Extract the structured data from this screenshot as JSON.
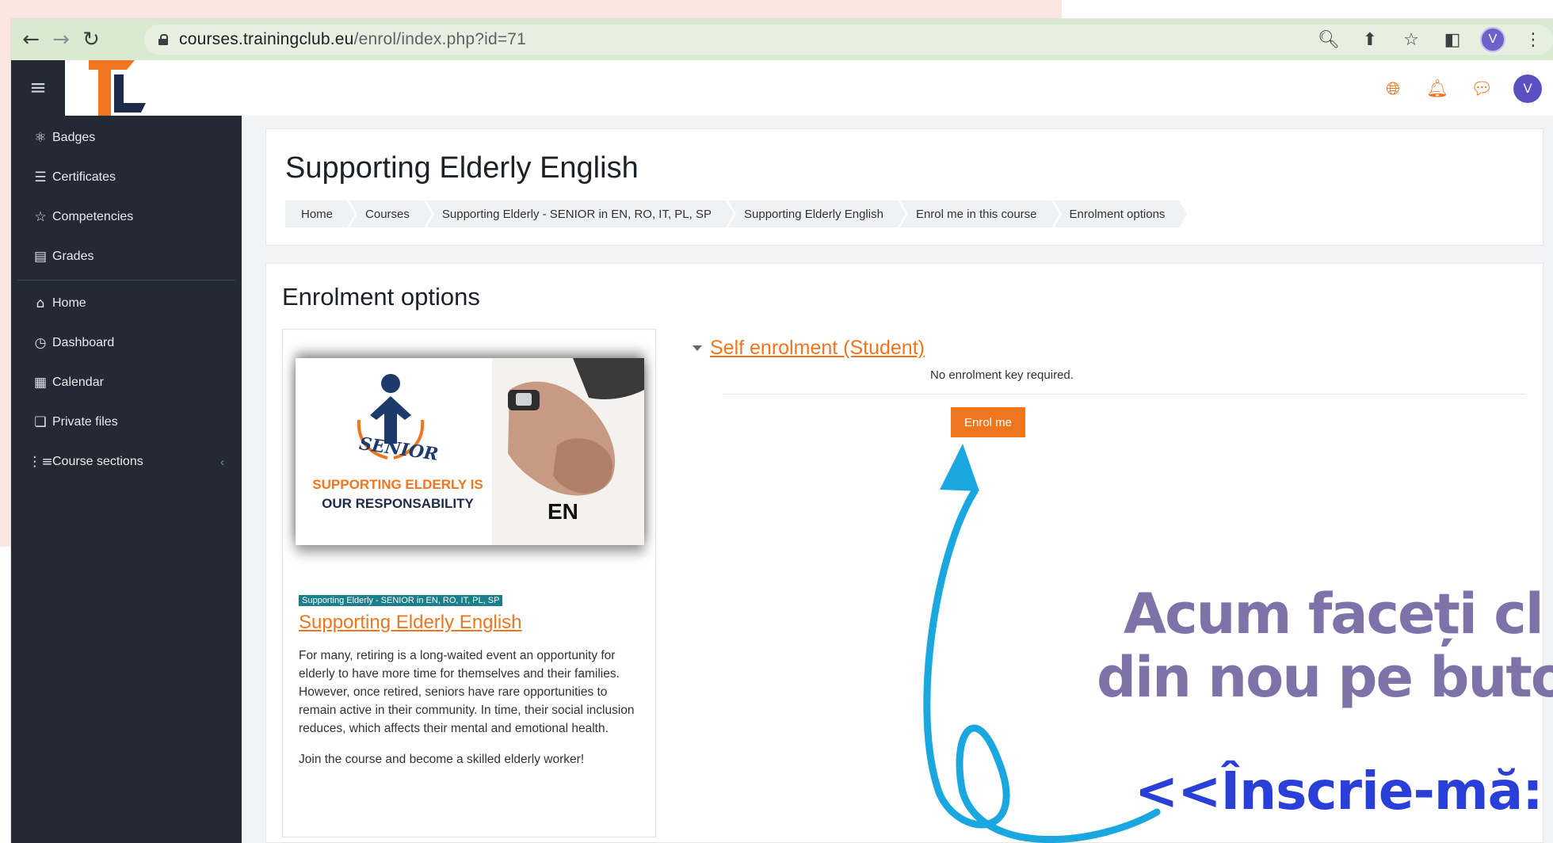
{
  "browser": {
    "url_host": "courses.trainingclub.eu",
    "url_path": "/enrol/index.php?id=71",
    "profile_initial": "V"
  },
  "header": {
    "avatar_initial": "V"
  },
  "sidebar": {
    "items": [
      {
        "label": "Badges",
        "icon": "badge-icon"
      },
      {
        "label": "Certificates",
        "icon": "certificate-icon"
      },
      {
        "label": "Competencies",
        "icon": "star-icon"
      },
      {
        "label": "Grades",
        "icon": "grades-icon"
      },
      {
        "label": "Home",
        "icon": "home-icon"
      },
      {
        "label": "Dashboard",
        "icon": "dashboard-icon"
      },
      {
        "label": "Calendar",
        "icon": "calendar-icon"
      },
      {
        "label": "Private files",
        "icon": "files-icon"
      },
      {
        "label": "Course sections",
        "icon": "list-icon"
      }
    ]
  },
  "page": {
    "title": "Supporting Elderly English",
    "breadcrumb": [
      "Home",
      "Courses",
      "Supporting Elderly - SENIOR in EN, RO, IT, PL, SP",
      "Supporting Elderly English",
      "Enrol me in this course",
      "Enrolment options"
    ],
    "section_title": "Enrolment options"
  },
  "course": {
    "image_text": {
      "senior": "SENIOR",
      "line1": "SUPPORTING ELDERLY IS",
      "line2": "OUR RESPONSABILITY",
      "lang": "EN"
    },
    "category": "Supporting Elderly - SENIOR in EN, RO, IT, PL, SP",
    "name": "Supporting Elderly English",
    "description_1": "For many, retiring is a long-waited event an opportunity for elderly to have more time for themselves and their families. However, once retired, seniors have rare opportunities to remain active in their community. In time, their social inclusion reduces, which affects their mental and emotional health.",
    "description_2": "Join the course and become a skilled elderly worker!"
  },
  "enrolment": {
    "method_title": "Self enrolment (Student)",
    "note": "No enrolment key required.",
    "button_label": "Enrol me"
  },
  "annotation": {
    "line1": "Acum faceți cl",
    "line2": "din nou pe buto",
    "line3": "<<Înscrie-mă:"
  },
  "colors": {
    "accent": "#f0751f",
    "sidebar_bg": "#232a33",
    "annotation_text": "#7d73a8",
    "annotation_highlight": "#2a3fd8",
    "arrow": "#1aa7e0"
  }
}
